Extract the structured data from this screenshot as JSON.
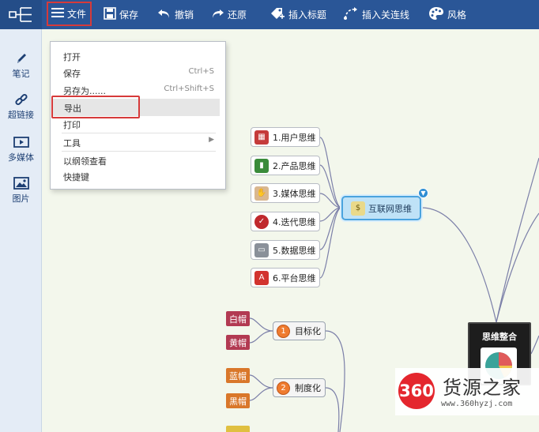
{
  "toolbar": {
    "file": "文件",
    "save": "保存",
    "undo": "撤销",
    "redo": "还原",
    "insert_tag": "插入标题",
    "insert_relation": "插入关连线",
    "style": "风格"
  },
  "sidebar": {
    "items": [
      {
        "label": "笔记",
        "icon": "pencil-icon"
      },
      {
        "label": "超链接",
        "icon": "link-icon"
      },
      {
        "label": "多媒体",
        "icon": "media-icon"
      },
      {
        "label": "图片",
        "icon": "image-icon"
      }
    ]
  },
  "file_menu": {
    "items": [
      {
        "label": "打开",
        "shortcut": ""
      },
      {
        "label": "保存",
        "shortcut": "Ctrl+S"
      },
      {
        "label": "另存为......",
        "shortcut": "Ctrl+Shift+S"
      },
      {
        "label": "导出",
        "shortcut": ""
      },
      {
        "label": "打印",
        "shortcut": ""
      },
      {
        "label": "工具",
        "shortcut": ""
      },
      {
        "label": "以纲领查看",
        "shortcut": ""
      },
      {
        "label": "快捷键",
        "shortcut": ""
      }
    ],
    "submenu_arrow": "▶"
  },
  "mindmap": {
    "central": "互联网思维",
    "children": [
      {
        "label": "1.用户思维",
        "icon": "calendar-icon",
        "color": "#c53b3b"
      },
      {
        "label": "2.产品思维",
        "icon": "book-icon",
        "color": "#3a8b3a"
      },
      {
        "label": "3.媒体思维",
        "icon": "thumb-icon",
        "color": "#d9b78f"
      },
      {
        "label": "4.迭代思维",
        "icon": "check-icon",
        "color": "#c0282d"
      },
      {
        "label": "5.数据思维",
        "icon": "printer-icon",
        "color": "#8a9099"
      },
      {
        "label": "6.平台思维",
        "icon": "letter-a-icon",
        "color": "#d2332f"
      }
    ],
    "branches": [
      {
        "num": "1",
        "label": "目标化"
      },
      {
        "num": "2",
        "label": "制度化"
      }
    ],
    "tags": [
      {
        "label": "白帽",
        "color": "#b23a52"
      },
      {
        "label": "黄帽",
        "color": "#b23a52"
      },
      {
        "label": "蓝帽",
        "color": "#d9772a"
      },
      {
        "label": "黑帽",
        "color": "#d9772a"
      },
      {
        "label": "",
        "color": "#e0c040"
      }
    ],
    "integration": "思维整合"
  },
  "watermark": {
    "badge": "360",
    "brand": "货源之家",
    "url": "www.360hyzj.com"
  }
}
